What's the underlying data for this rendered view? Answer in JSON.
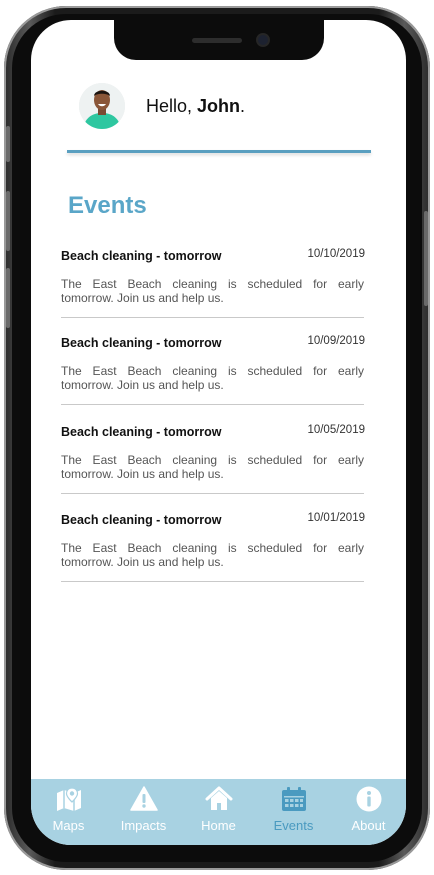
{
  "header": {
    "greeting_prefix": "Hello, ",
    "user_name": "John",
    "greeting_suffix": "."
  },
  "events": {
    "title": "Events",
    "items": [
      {
        "title": "Beach cleaning - tomorrow",
        "date": "10/10/2019",
        "description": "The East Beach cleaning is scheduled for early tomorrow. Join us and help us."
      },
      {
        "title": "Beach cleaning - tomorrow",
        "date": "10/09/2019",
        "description": "The East Beach cleaning is scheduled for early tomorrow. Join us and help us."
      },
      {
        "title": "Beach cleaning - tomorrow",
        "date": "10/05/2019",
        "description": "The East Beach cleaning is scheduled for early tomorrow. Join us and help us."
      },
      {
        "title": "Beach cleaning - tomorrow",
        "date": "10/01/2019",
        "description": "The East Beach cleaning is scheduled for early tomorrow. Join us and help us."
      }
    ]
  },
  "nav": {
    "items": [
      {
        "label": "Maps",
        "icon": "map-icon"
      },
      {
        "label": "Impacts",
        "icon": "warning-icon"
      },
      {
        "label": "Home",
        "icon": "home-icon"
      },
      {
        "label": "Events",
        "icon": "calendar-icon",
        "active": true
      },
      {
        "label": "About",
        "icon": "info-icon"
      }
    ]
  },
  "colors": {
    "accent": "#5aa6c8",
    "nav_bg": "#a8d2e2",
    "nav_active": "#4a9ac0"
  }
}
